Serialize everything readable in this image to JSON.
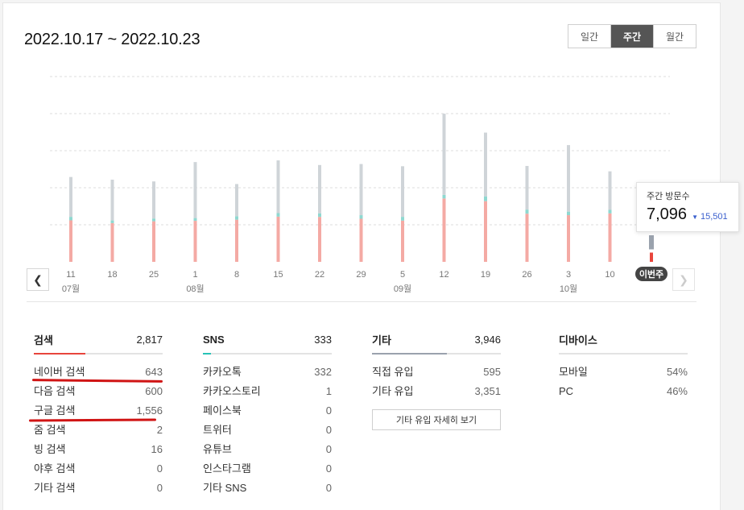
{
  "header": {
    "date_range": "2022.10.17 ~ 2022.10.23",
    "period_tabs": [
      {
        "label": "일간",
        "active": false
      },
      {
        "label": "주간",
        "active": true
      },
      {
        "label": "월간",
        "active": false
      }
    ]
  },
  "colors": {
    "bar_gray": "#cfd4d8",
    "bar_red": "#f4aaa4",
    "bar_teal": "#8fd8d0",
    "current_gray": "#9aa2ad",
    "current_red": "#e8453c",
    "grid": "#dcdcdc",
    "search_accent": "#e8453c",
    "sns_accent": "#27c2b6",
    "etc_accent": "#9aa2ad"
  },
  "chart_data": {
    "type": "bar",
    "stacked": true,
    "categories": [
      "11",
      "18",
      "25",
      "1",
      "8",
      "15",
      "22",
      "29",
      "5",
      "12",
      "19",
      "26",
      "3",
      "10",
      "이번주"
    ],
    "month_labels": [
      {
        "at": "11",
        "label": "07월"
      },
      {
        "at": "1",
        "label": "08월"
      },
      {
        "at": "5",
        "label": "09월"
      },
      {
        "at": "3",
        "label": "10월"
      }
    ],
    "series": [
      {
        "name": "검색",
        "color": "#f4aaa4",
        "values": [
          4480,
          4180,
          4380,
          4430,
          4550,
          4880,
          4850,
          4650,
          4450,
          6840,
          6550,
          5200,
          5040,
          5230,
          1000
        ]
      },
      {
        "name": "SNS",
        "color": "#8fd8d0",
        "values": [
          380,
          290,
          300,
          300,
          380,
          380,
          390,
          390,
          410,
          390,
          520,
          440,
          380,
          380,
          0
        ]
      },
      {
        "name": "기타",
        "color": "#cfd4d8",
        "values": [
          4300,
          4400,
          4000,
          6040,
          3470,
          5690,
          5210,
          5520,
          5460,
          8760,
          6880,
          4710,
          7180,
          4160,
          1520
        ]
      }
    ],
    "current": {
      "label": "이번주",
      "total": 7096
    },
    "grid_lines": 5,
    "ylim": [
      0,
      20000
    ]
  },
  "tooltip": {
    "label": "주간 방문수",
    "value": "7,096",
    "delta": "15,501"
  },
  "stats": {
    "search": {
      "title": "검색",
      "total": "2,817",
      "fill": 0.4,
      "rows": [
        {
          "label": "네이버 검색",
          "value": "643"
        },
        {
          "label": "다음 검색",
          "value": "600"
        },
        {
          "label": "구글 검색",
          "value": "1,556"
        },
        {
          "label": "줌 검색",
          "value": "2"
        },
        {
          "label": "빙 검색",
          "value": "16"
        },
        {
          "label": "야후 검색",
          "value": "0"
        },
        {
          "label": "기타 검색",
          "value": "0"
        }
      ]
    },
    "sns": {
      "title": "SNS",
      "total": "333",
      "fill": 0.06,
      "rows": [
        {
          "label": "카카오톡",
          "value": "332"
        },
        {
          "label": "카카오스토리",
          "value": "1"
        },
        {
          "label": "페이스북",
          "value": "0"
        },
        {
          "label": "트위터",
          "value": "0"
        },
        {
          "label": "유튜브",
          "value": "0"
        },
        {
          "label": "인스타그램",
          "value": "0"
        },
        {
          "label": "기타 SNS",
          "value": "0"
        }
      ]
    },
    "etc": {
      "title": "기타",
      "total": "3,946",
      "fill": 0.58,
      "rows": [
        {
          "label": "직접 유입",
          "value": "595"
        },
        {
          "label": "기타 유입",
          "value": "3,351"
        }
      ],
      "detail_button": "기타 유입 자세히 보기"
    },
    "device": {
      "title": "디바이스",
      "total": "",
      "rows": [
        {
          "label": "모바일",
          "value": "54%"
        },
        {
          "label": "PC",
          "value": "46%"
        }
      ]
    }
  }
}
